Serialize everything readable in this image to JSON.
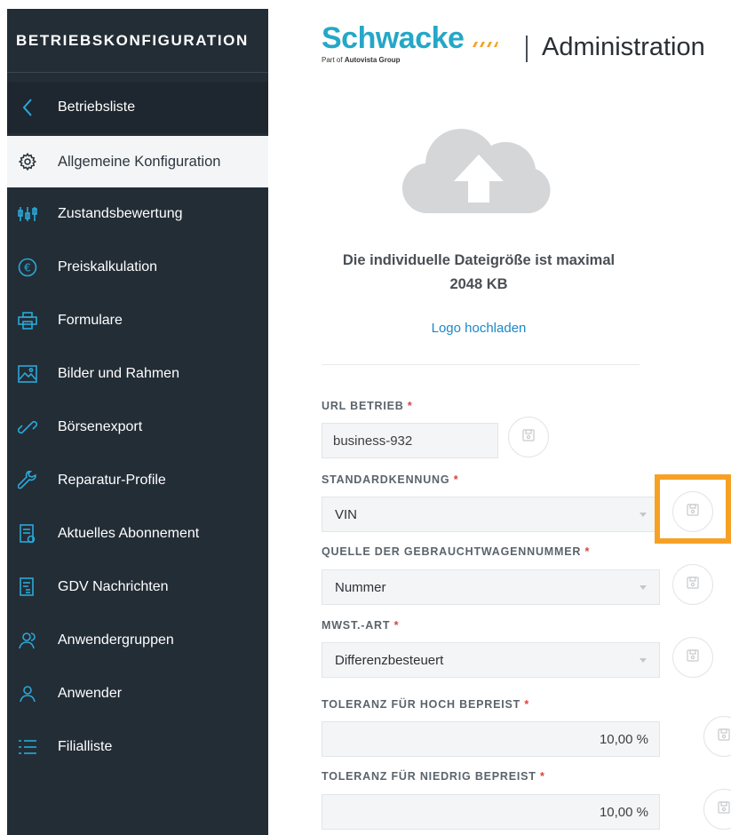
{
  "sidebar": {
    "title": "BETRIEBSKONFIGURATION",
    "back_label": "Betriebsliste",
    "active_label": "Allgemeine Konfiguration",
    "items": [
      {
        "label": "Zustandsbewertung",
        "icon": "slider-icon"
      },
      {
        "label": "Preiskalkulation",
        "icon": "euro-icon"
      },
      {
        "label": "Formulare",
        "icon": "printer-icon"
      },
      {
        "label": "Bilder und Rahmen",
        "icon": "image-icon"
      },
      {
        "label": "Börsenexport",
        "icon": "link-icon"
      },
      {
        "label": "Reparatur-Profile",
        "icon": "wrench-icon"
      },
      {
        "label": "Aktuelles Abonnement",
        "icon": "document-icon"
      },
      {
        "label": "GDV Nachrichten",
        "icon": "message-document-icon"
      },
      {
        "label": "Anwendergruppen",
        "icon": "users-icon"
      },
      {
        "label": "Anwender",
        "icon": "user-icon"
      },
      {
        "label": "Filialliste",
        "icon": "list-icon"
      }
    ]
  },
  "header": {
    "logo_text": "Schwacke",
    "logo_sub_prefix": "Part of",
    "logo_sub_brand": "Autovista Group",
    "title": "Administration"
  },
  "upload": {
    "size_line1": "Die individuelle Dateigröße ist maximal",
    "size_line2": "2048 KB",
    "link_label": "Logo hochladen"
  },
  "form": {
    "url_label": "URL BETRIEB",
    "url_value": "business-932",
    "standard_label": "STANDARDKENNUNG",
    "standard_value": "VIN",
    "source_label": "QUELLE DER GEBRAUCHTWAGENNUMMER",
    "source_value": "Nummer",
    "vat_label": "MWST.-ART",
    "vat_value": "Differenzbesteuert",
    "tol_high_label": "TOLERANZ FÜR HOCH BEPREIST",
    "tol_high_value": "10,00 %",
    "tol_low_label": "TOLERANZ FÜR NIEDRIG BEPREIST",
    "tol_low_value": "10,00 %",
    "required_mark": "*"
  },
  "colors": {
    "sidebar_bg": "#232d36",
    "accent_blue": "#25a7c7",
    "link_blue": "#1c87c9",
    "highlight_orange": "#f6a125",
    "required_red": "#d9433e"
  }
}
